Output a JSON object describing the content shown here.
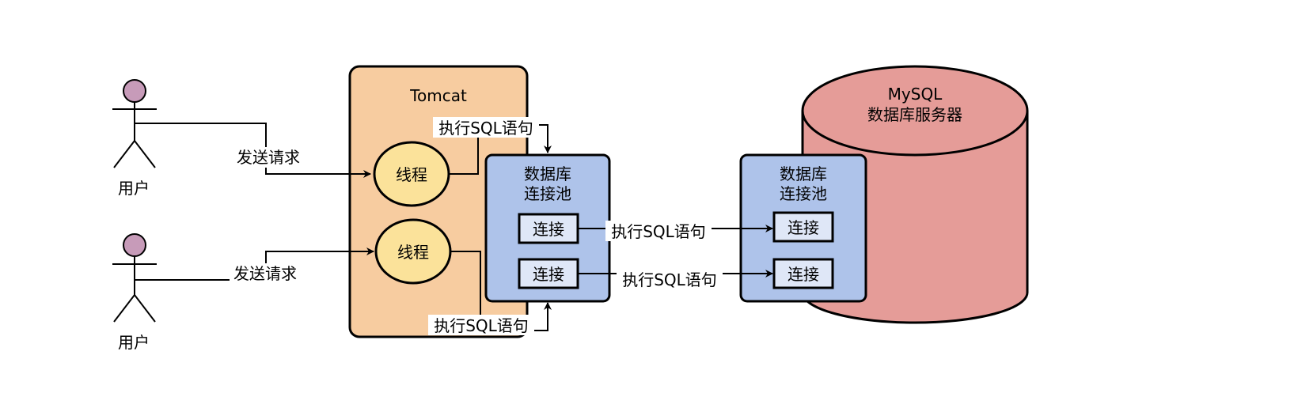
{
  "colors": {
    "tomcat_fill": "#f7cca0",
    "thread_fill": "#fbe29a",
    "pool_fill": "#aec3ea",
    "conn_fill": "#dfe7f7",
    "mysql_fill": "#e59c98",
    "user_head_fill": "#c79bb9",
    "stroke": "#000000"
  },
  "icons": {
    "user": "stick-figure-actor",
    "database": "cylinder"
  },
  "users": [
    {
      "label": "用户"
    },
    {
      "label": "用户"
    }
  ],
  "tomcat": {
    "title": "Tomcat",
    "threads": [
      {
        "label": "线程"
      },
      {
        "label": "线程"
      }
    ]
  },
  "app_pool": {
    "title_line1": "数据库",
    "title_line2": "连接池",
    "connections": [
      {
        "label": "连接"
      },
      {
        "label": "连接"
      }
    ]
  },
  "mysql": {
    "title_line1": "MySQL",
    "title_line2": "数据库服务器",
    "pool": {
      "title_line1": "数据库",
      "title_line2": "连接池",
      "connections": [
        {
          "label": "连接"
        },
        {
          "label": "连接"
        }
      ]
    }
  },
  "edges": {
    "user1_to_thread1": "发送请求",
    "user2_to_thread2": "发送请求",
    "thread1_to_pool": "执行SQL语句",
    "thread2_to_pool": "执行SQL语句",
    "conn1_to_mysql": "执行SQL语句",
    "conn2_to_mysql": "执行SQL语句"
  }
}
